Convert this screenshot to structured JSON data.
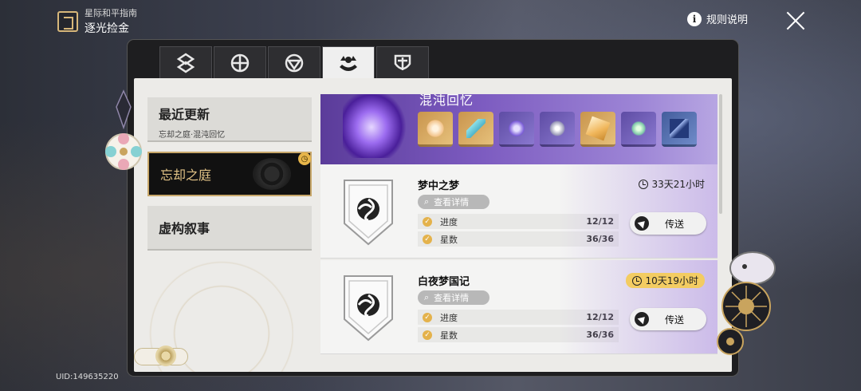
{
  "header": {
    "subtitle": "星际和平指南",
    "title": "逐光捡金",
    "rules_label": "规则说明",
    "rules_icon": "info-icon",
    "close_icon": "close-icon"
  },
  "tabs": [
    {
      "icon": "mode-1-icon",
      "active": false
    },
    {
      "icon": "mode-2-icon",
      "active": false
    },
    {
      "icon": "mode-3-icon",
      "active": false
    },
    {
      "icon": "memory-of-chaos-icon",
      "active": true
    },
    {
      "icon": "mode-5-icon",
      "active": false
    }
  ],
  "nav": {
    "recent": {
      "label": "最近更新",
      "sub": "忘却之庭·混沌回忆"
    },
    "forgotten_hall": {
      "label": "忘却之庭"
    },
    "pure_fiction": {
      "label": "虚构叙事"
    }
  },
  "banner": {
    "title": "混沌回忆",
    "rewards": [
      {
        "icon": "crystal-reward-icon",
        "rarity": "gold"
      },
      {
        "icon": "feather-reward-icon",
        "rarity": "gold"
      },
      {
        "icon": "material-reward-icon",
        "rarity": "purple"
      },
      {
        "icon": "material-reward-icon",
        "rarity": "purple"
      },
      {
        "icon": "book-reward-icon",
        "rarity": "gold"
      },
      {
        "icon": "material-reward-icon",
        "rarity": "purple"
      },
      {
        "icon": "ticket-reward-icon",
        "rarity": "blue"
      }
    ]
  },
  "stages": [
    {
      "name": "梦中之梦",
      "details_label": "查看详情",
      "progress_label": "进度",
      "progress_value": "12/12",
      "stars_label": "星数",
      "stars_value": "36/36",
      "timer": "33天21小时",
      "timer_warning": false,
      "teleport_label": "传送"
    },
    {
      "name": "白夜梦国记",
      "details_label": "查看详情",
      "progress_label": "进度",
      "progress_value": "12/12",
      "stars_label": "星数",
      "stars_value": "36/36",
      "timer": "10天19小时",
      "timer_warning": true,
      "teleport_label": "传送"
    }
  ],
  "footer": {
    "uid": "UID:149635220"
  },
  "colors": {
    "accent_gold": "#c8a76a",
    "warning_yellow": "#f3cc62",
    "banner_purple": "#7c5bc0"
  }
}
